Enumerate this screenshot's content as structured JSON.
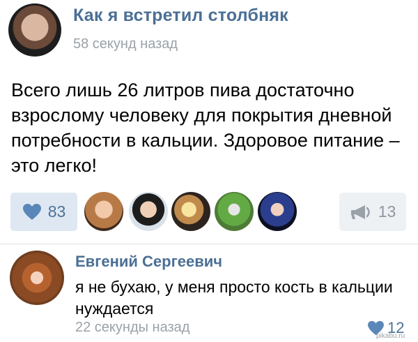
{
  "post": {
    "author": "Как я встретил столбняк",
    "time": "58 секунд назад",
    "text": "Всего лишь 26 литров пива достаточно взрослому человеку для покрытия дневной потребности в кальции. Здоровое питание – это легко!",
    "likes": "83",
    "shares": "13",
    "like_icon": "heart-icon",
    "share_icon": "megaphone-icon"
  },
  "comment": {
    "author": "Евгений Сергеевич",
    "text": "я не бухаю, у меня просто кость в кальции нуждается",
    "time": "22 секунды назад",
    "likes": "12"
  },
  "watermark": "pikabu.ru",
  "colors": {
    "accent": "#4b6f95",
    "muted": "#9aa1a8",
    "like_bg": "#dfe8f2",
    "share_bg": "#eef1f4"
  }
}
